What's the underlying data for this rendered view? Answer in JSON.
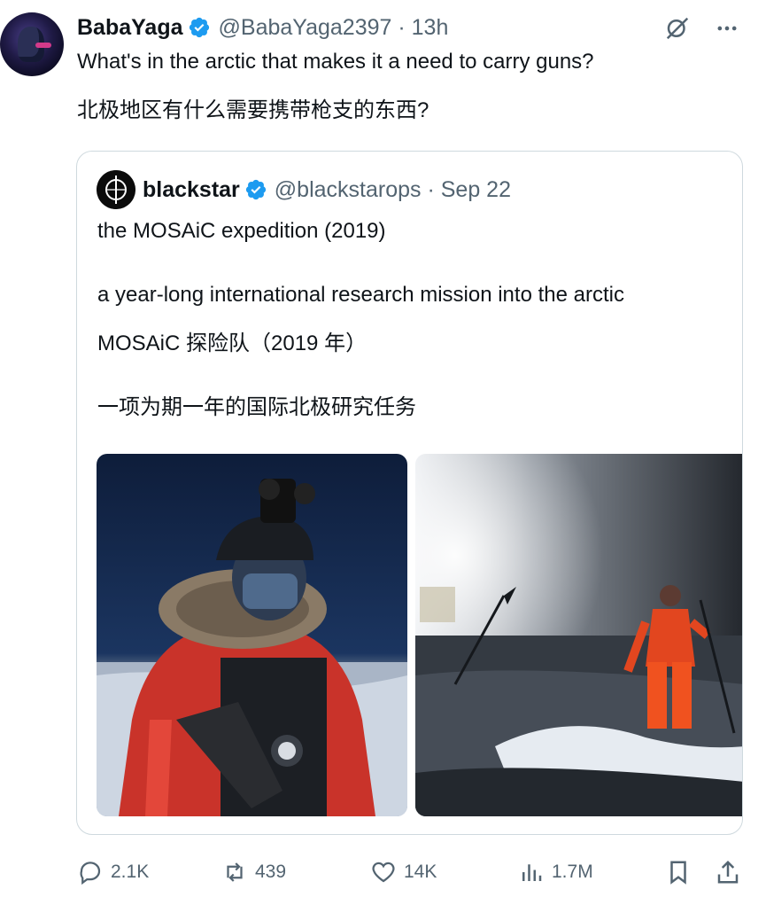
{
  "tweet": {
    "author_name": "BabaYaga",
    "handle_time": "@BabaYaga2397 · 13h",
    "text_en": "What's in the arctic that makes it a need to carry guns?",
    "text_zh": "北极地区有什么需要携带枪支的东西?"
  },
  "quote": {
    "author_name": "blackstar",
    "handle_time": "@blackstarops · Sep 22",
    "line1": "the MOSAiC expedition (2019)",
    "line2": "a year-long international research mission into the arctic",
    "line3": "MOSAiC 探险队（2019 年）",
    "line4": "一项为期一年的国际北极研究任务"
  },
  "actions": {
    "replies": "2.1K",
    "reposts": "439",
    "likes": "14K",
    "views": "1.7M"
  },
  "colors": {
    "verified": "#1d9bf0",
    "secondary_text": "#536471",
    "border": "#cfd9de"
  }
}
